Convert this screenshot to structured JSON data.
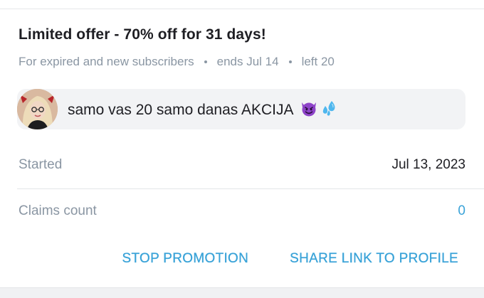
{
  "promotion": {
    "title": "Limited offer - 70% off for 31 days!",
    "audience": "For expired and new subscribers",
    "ends": "ends Jul 14",
    "left": "left 20"
  },
  "message": {
    "text": "samo vas 20 samo danas AKCIJA",
    "icons": [
      "smiling-devil-emoji-icon",
      "sweat-droplets-emoji-icon"
    ]
  },
  "details": {
    "started_label": "Started",
    "started_value": "Jul 13, 2023",
    "claims_label": "Claims count",
    "claims_value": "0"
  },
  "actions": {
    "stop_label": "STOP PROMOTION",
    "share_label": "SHARE LINK TO PROFILE"
  },
  "colors": {
    "accent": "#3aa3d8",
    "muted_text": "#8a96a3",
    "primary_text": "#1e1e23",
    "bubble_bg": "#f2f3f5",
    "emoji_devil": "#8e44c9",
    "emoji_drops": "#4fb7ee"
  }
}
